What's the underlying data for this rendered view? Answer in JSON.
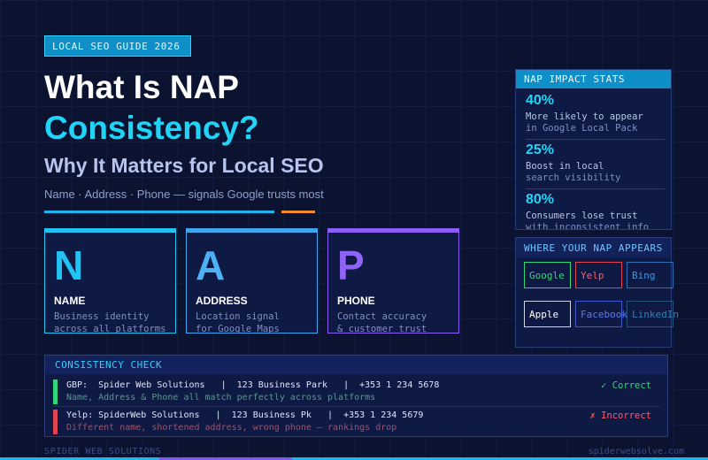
{
  "header": {
    "tag": "LOCAL SEO GUIDE 2026",
    "title_line1": "What Is NAP",
    "title_line2": "Consistency?",
    "subtitle": "Why It Matters for Local SEO",
    "tagline": "Name · Address · Phone — signals Google trusts most"
  },
  "nap_cards": [
    {
      "letter": "N",
      "heading": "NAME",
      "desc_line1": "Business identity",
      "desc_line2": "across all platforms"
    },
    {
      "letter": "A",
      "heading": "ADDRESS",
      "desc_line1": "Location signal",
      "desc_line2": "for Google Maps"
    },
    {
      "letter": "P",
      "heading": "PHONE",
      "desc_line1": "Contact accuracy",
      "desc_line2": "& customer trust"
    }
  ],
  "stats": {
    "header": "NAP IMPACT STATS",
    "items": [
      {
        "value": "40%",
        "label_line1": "More likely to appear",
        "label_line2": "in Google Local Pack"
      },
      {
        "value": "25%",
        "label_line1": "Boost in local",
        "label_line2": "search visibility"
      },
      {
        "value": "80%",
        "label_line1": "Consumers lose trust",
        "label_line2": "with inconsistent info"
      }
    ]
  },
  "platforms": {
    "header": "WHERE YOUR NAP APPEARS",
    "items": [
      "Google",
      "Yelp",
      "Bing",
      "Apple",
      "Facebook",
      "LinkedIn"
    ]
  },
  "consistency": {
    "header": "CONSISTENCY CHECK",
    "rows": [
      {
        "line1": "GBP:  Spider Web Solutions   |  123 Business Park   |  +353 1 234 5678",
        "line2": "Name, Address & Phone all match perfectly across platforms",
        "status": "✓ Correct"
      },
      {
        "line1": "Yelp: SpiderWeb Solutions   |  123 Business Pk   |  +353 1 234 5679",
        "line2": "Different name, shortened address, wrong phone — rankings drop",
        "status": "✗ Incorrect"
      }
    ]
  },
  "footer": {
    "brand": "SPIDER WEB SOLUTIONS",
    "site": "spiderwebsolve.com"
  },
  "colors": {
    "background": "#0b1330",
    "accent_cyan": "#21d4f7",
    "accent_orange": "#f28a2c",
    "correct_green": "#2fd77a",
    "incorrect_red": "#e0424f",
    "violet": "#8b5cf6"
  }
}
